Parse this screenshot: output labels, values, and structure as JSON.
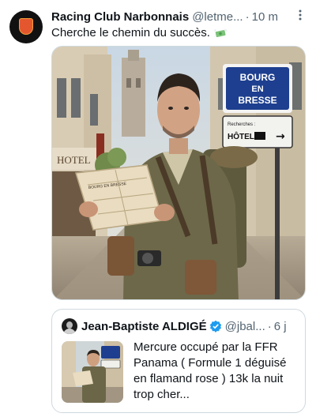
{
  "tweet": {
    "display_name": "Racing Club Narbonnais",
    "handle": "@letme...",
    "separator": "·",
    "time": "10 m",
    "more_icon": "more-vertical-icon",
    "text": "Cherche le chemin du succès.",
    "emoji": "money-with-wings-emoji"
  },
  "photo": {
    "sign_line1": "BOURG",
    "sign_line2": "EN",
    "sign_line3": "BRESSE",
    "hotel_sign_small": "Recherches :",
    "hotel_sign_main": "HÔTEL",
    "hotel_sign_arrow": "→",
    "building_sign": "HOTEL",
    "map_text": "BOURG EN BRESSE"
  },
  "quote": {
    "display_name": "Jean-Baptiste ALDIGÉ",
    "verified_icon": "verified-badge-icon",
    "handle": "@jbal...",
    "separator": "·",
    "time": "6 j",
    "text": "Mercure occupé par la FFR Panama ( Formule 1 déguisé en flamand rose ) 13k la nuit trop cher...",
    "colors": {
      "verified": "#1d9bf0"
    }
  },
  "colors": {
    "text_primary": "#0f1419",
    "text_secondary": "#536471",
    "border": "#cfd9de",
    "sign_blue": "#1e3f8f"
  }
}
